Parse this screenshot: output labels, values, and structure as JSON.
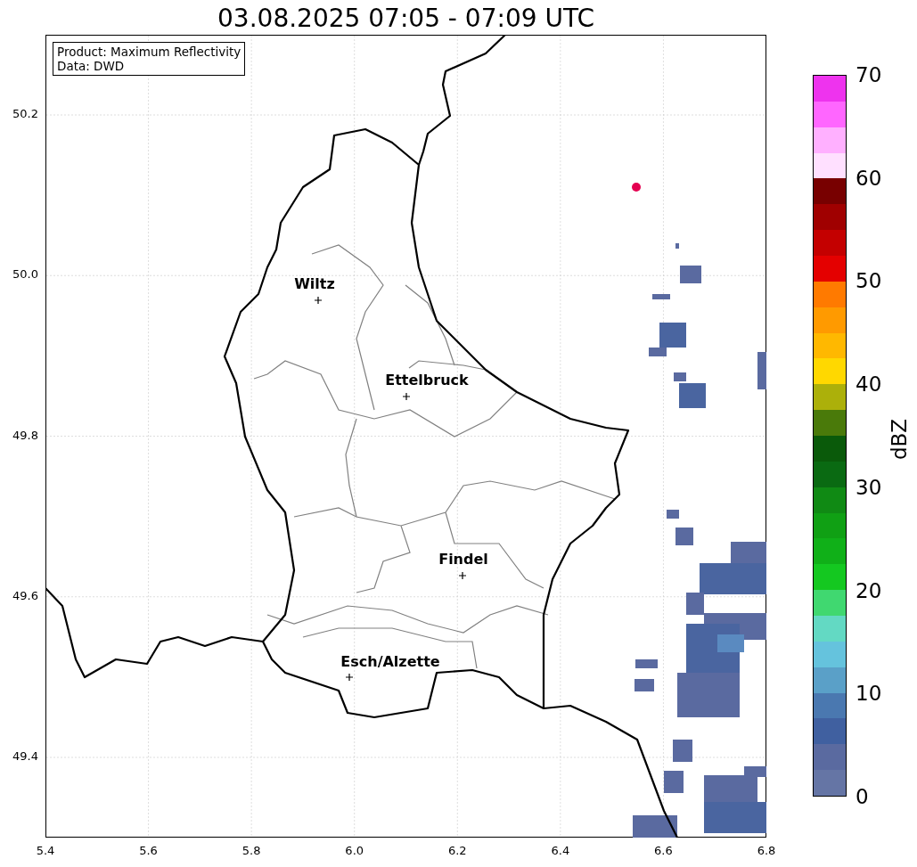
{
  "title": "03.08.2025 07:05 - 07:09 UTC",
  "info_box": [
    "Product: Maximum Reflectivity",
    "Data: DWD"
  ],
  "map": {
    "xticks": [
      "5.4",
      "5.6",
      "5.8",
      "6.0",
      "6.2",
      "6.4",
      "6.6",
      "6.8"
    ],
    "yticks": [
      "50.2",
      "50.0",
      "49.8",
      "49.6",
      "49.4"
    ],
    "cities": [
      {
        "name": "Wiltz"
      },
      {
        "name": "Ettelbruck"
      },
      {
        "name": "Findel"
      },
      {
        "name": "Esch/Alzette"
      }
    ]
  },
  "colorbar": {
    "label": "dBZ",
    "ticks": [
      "70",
      "60",
      "50",
      "40",
      "30",
      "20",
      "10",
      "0"
    ],
    "segments": [
      {
        "color": "#ee33ee"
      },
      {
        "color": "#ff66ff"
      },
      {
        "color": "#ffb0ff"
      },
      {
        "color": "#ffe0ff"
      },
      {
        "color": "#780000"
      },
      {
        "color": "#a00000"
      },
      {
        "color": "#c40000"
      },
      {
        "color": "#e40000"
      },
      {
        "color": "#ff7a00"
      },
      {
        "color": "#ff9a00"
      },
      {
        "color": "#ffb800"
      },
      {
        "color": "#ffd800"
      },
      {
        "color": "#acb00a"
      },
      {
        "color": "#4a7a0a"
      },
      {
        "color": "#0a5a0a"
      },
      {
        "color": "#0a6a12"
      },
      {
        "color": "#108a14"
      },
      {
        "color": "#10a014"
      },
      {
        "color": "#10b018"
      },
      {
        "color": "#14c820"
      },
      {
        "color": "#40d870"
      },
      {
        "color": "#63d9c3"
      },
      {
        "color": "#65c3dd"
      },
      {
        "color": "#5aa0c8"
      },
      {
        "color": "#4a78b0"
      },
      {
        "color": "#4060a0"
      },
      {
        "color": "#5a6aa0"
      },
      {
        "color": "#6575a5"
      }
    ]
  }
}
